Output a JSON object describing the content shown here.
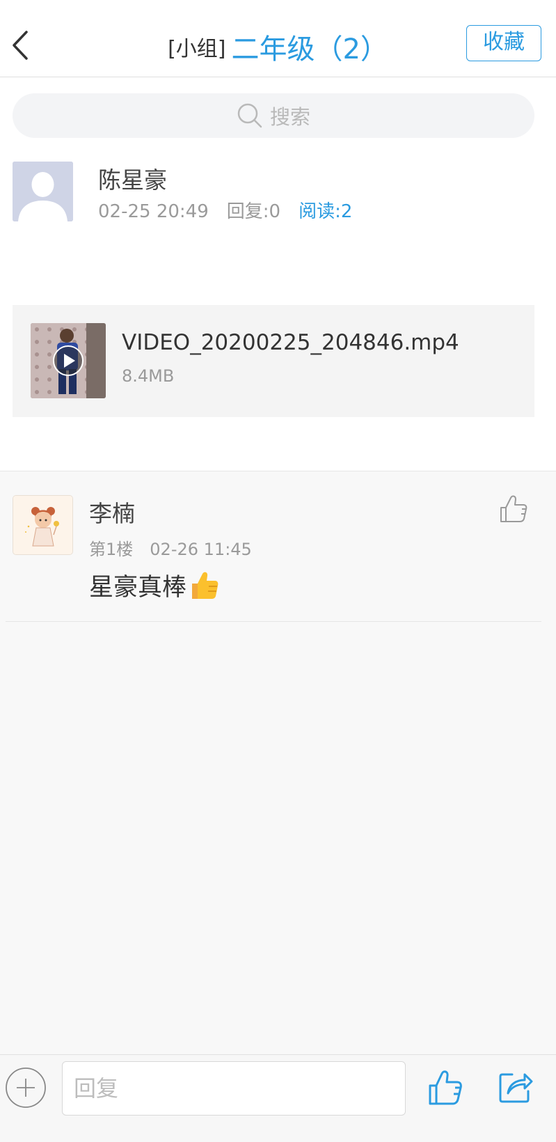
{
  "header": {
    "title_prefix": "[小组]",
    "title_name": "二年级（2）",
    "collect_label": "收藏"
  },
  "search": {
    "placeholder": "搜索"
  },
  "post": {
    "author": "陈星豪",
    "datetime": "02-25 20:49",
    "replies": "回复:0",
    "reads": "阅读:2",
    "attachment": {
      "file_name": "VIDEO_20200225_204846.mp4",
      "file_size": "8.4MB",
      "type_icon": "play-icon"
    }
  },
  "replies": [
    {
      "author": "李楠",
      "floor": "第1楼",
      "datetime": "02-26 11:45",
      "content": "星豪真棒",
      "emoji": "thumbs-up-emoji"
    }
  ],
  "bottom_bar": {
    "reply_placeholder": "回复",
    "icons": [
      "plus-icon",
      "thumbs-up-icon",
      "share-icon"
    ]
  },
  "colors": {
    "accent": "#2b9be0",
    "text_primary": "#333333",
    "text_secondary": "#9a9a9a",
    "background_gray": "#f8f8f8"
  }
}
